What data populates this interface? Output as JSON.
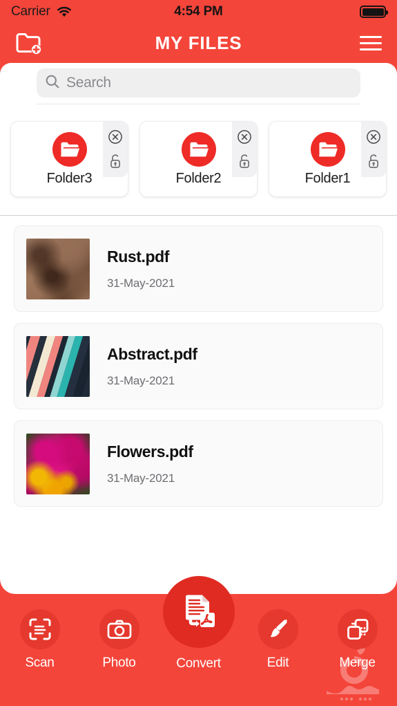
{
  "status_bar": {
    "carrier": "Carrier",
    "time": "4:54 PM",
    "wifi_icon": "wifi-icon",
    "battery_icon": "battery-full-icon"
  },
  "nav_bar": {
    "title": "MY FILES",
    "new_folder_icon": "folder-add-icon",
    "menu_icon": "hamburger-menu-icon"
  },
  "search": {
    "placeholder": "Search",
    "value": "",
    "icon": "search-icon"
  },
  "folders": {
    "items": [
      {
        "name": "Folder3",
        "folder_icon": "folder-icon",
        "close_icon": "close-circle-icon",
        "lock_icon": "unlock-icon"
      },
      {
        "name": "Folder2",
        "folder_icon": "folder-icon",
        "close_icon": "close-circle-icon",
        "lock_icon": "unlock-icon"
      },
      {
        "name": "Folder1",
        "folder_icon": "folder-icon",
        "close_icon": "close-circle-icon",
        "lock_icon": "unlock-icon"
      }
    ]
  },
  "files": {
    "items": [
      {
        "name": "Rust.pdf",
        "date": "31-May-2021",
        "thumb": "rust-texture-thumbnail"
      },
      {
        "name": "Abstract.pdf",
        "date": "31-May-2021",
        "thumb": "abstract-stripes-thumbnail"
      },
      {
        "name": "Flowers.pdf",
        "date": "31-May-2021",
        "thumb": "pink-flowers-thumbnail"
      }
    ]
  },
  "tab_bar": {
    "items": [
      {
        "label": "Scan",
        "icon": "scan-document-icon"
      },
      {
        "label": "Photo",
        "icon": "camera-icon"
      },
      {
        "label": "Convert",
        "icon": "convert-pdf-icon"
      },
      {
        "label": "Edit",
        "icon": "paintbrush-icon"
      },
      {
        "label": "Merge",
        "icon": "merge-squares-icon"
      }
    ]
  },
  "watermark": {
    "name": "sibapp-logo-watermark"
  },
  "colors": {
    "brand_red": "#F4453A",
    "icon_red": "#EE2B26",
    "tab_circle_red": "#E5382E",
    "sheet_white": "#FFFFFF",
    "card_gray": "#FAFAFA",
    "search_gray": "#EFEFF0",
    "text_dark": "#111111",
    "text_muted": "#6E6E73"
  }
}
